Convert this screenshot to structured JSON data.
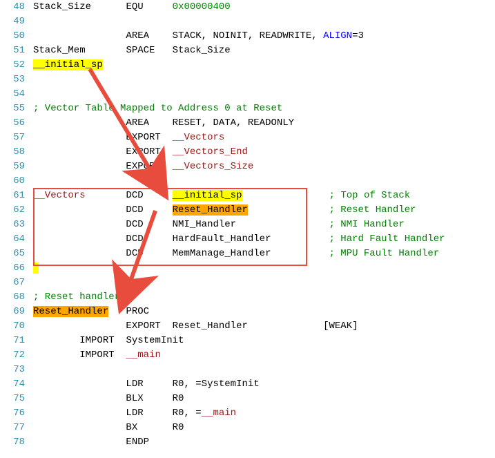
{
  "lines": {
    "48": {
      "no": "48",
      "c1": "Stack_Size",
      "c2": "EQU",
      "c3a": "0x00000400"
    },
    "49": {
      "no": "49"
    },
    "50": {
      "no": "50",
      "c2": "AREA",
      "c3": "STACK, NOINIT, READWRITE, ",
      "c3b": "ALIGN",
      "c3c": "=3"
    },
    "51": {
      "no": "51",
      "c1": "Stack_Mem",
      "c2": "SPACE",
      "c3": "Stack_Size"
    },
    "52": {
      "no": "52",
      "c1": "__initial_sp"
    },
    "53": {
      "no": "53"
    },
    "54": {
      "no": "54"
    },
    "55": {
      "no": "55",
      "cmt": "; Vector Table Mapped to Address 0 at Reset"
    },
    "56": {
      "no": "56",
      "c2": "AREA",
      "c3": "RESET, DATA, READONLY"
    },
    "57": {
      "no": "57",
      "c2": "EXPORT",
      "c3r": "__Vectors"
    },
    "58": {
      "no": "58",
      "c2": "EXPORT",
      "c3r": "__Vectors_End"
    },
    "59": {
      "no": "59",
      "c2": "EXPORT",
      "c3r": "__Vectors_Size"
    },
    "60": {
      "no": "60"
    },
    "61": {
      "no": "61",
      "c1r": "__Vectors",
      "c2": "DCD",
      "c3hy": "__initial_sp",
      "cmt2": "; Top of Stack"
    },
    "62": {
      "no": "62",
      "c2": "DCD",
      "c3ho": "Reset_Handler",
      "cmt2": "; Reset Handler"
    },
    "63": {
      "no": "63",
      "c2": "DCD",
      "c3": "NMI_Handler",
      "cmt2": "; NMI Handler"
    },
    "64": {
      "no": "64",
      "c2": "DCD",
      "c3": "HardFault_Handler",
      "cmt2": "; Hard Fault Handler"
    },
    "65": {
      "no": "65",
      "c2": "DCD",
      "c3": "MemManage_Handler",
      "cmt2": "; MPU Fault Handler"
    },
    "66": {
      "no": "66"
    },
    "67": {
      "no": "67"
    },
    "68": {
      "no": "68",
      "cmt": "; Reset handler"
    },
    "69": {
      "no": "69",
      "c1ho": "Reset_Handler",
      "c2": "PROC"
    },
    "70": {
      "no": "70",
      "c2": "EXPORT",
      "c3": "Reset_Handler",
      "c4": "[WEAK]"
    },
    "71": {
      "no": "71",
      "c1b": "IMPORT",
      "c2b": "SystemInit"
    },
    "72": {
      "no": "72",
      "c1b": "IMPORT",
      "c2r": "__main"
    },
    "73": {
      "no": "73"
    },
    "74": {
      "no": "74",
      "c2": "LDR",
      "c3": "R0, =SystemInit"
    },
    "75": {
      "no": "75",
      "c2": "BLX",
      "c3": "R0"
    },
    "76": {
      "no": "76",
      "c2": "LDR",
      "c3a": "R0, =",
      "c3r": "__main"
    },
    "77": {
      "no": "77",
      "c2": "BX",
      "c3": "R0"
    },
    "78": {
      "no": "78",
      "c2": "ENDP"
    }
  }
}
